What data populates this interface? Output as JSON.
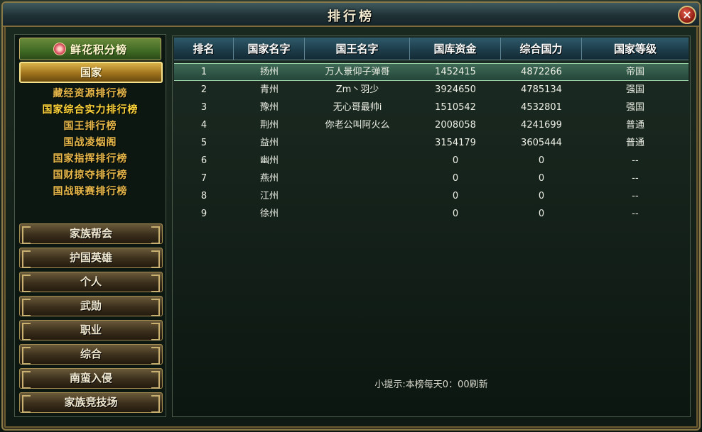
{
  "window": {
    "title": "排行榜",
    "close_label": "×"
  },
  "sidebar": {
    "header_label": "鲜花积分榜",
    "selected_category": "国家",
    "sub_items": [
      "藏经资源排行榜",
      "国家综合实力排行榜",
      "国王排行榜",
      "国战凌烟阁",
      "国家指挥排行榜",
      "国财掠夺排行榜",
      "国战联赛排行榜"
    ],
    "categories": [
      "家族帮会",
      "护国英雄",
      "个人",
      "武勋",
      "职业",
      "综合",
      "南蛮入侵",
      "家族竞技场"
    ]
  },
  "table": {
    "headers": [
      "排名",
      "国家名字",
      "国王名字",
      "国库资金",
      "综合国力",
      "国家等级"
    ],
    "rows": [
      [
        "1",
        "扬州",
        "万人景仰子弹哥",
        "1452415",
        "4872266",
        "帝国"
      ],
      [
        "2",
        "青州",
        "Zm丶羽少",
        "3924650",
        "4785134",
        "强国"
      ],
      [
        "3",
        "豫州",
        "无心哥最帅i",
        "1510542",
        "4532801",
        "强国"
      ],
      [
        "4",
        "荆州",
        "你老公叫阿火么",
        "2008058",
        "4241699",
        "普通"
      ],
      [
        "5",
        "益州",
        "",
        "3154179",
        "3605444",
        "普通"
      ],
      [
        "6",
        "幽州",
        "",
        "0",
        "0",
        "--"
      ],
      [
        "7",
        "燕州",
        "",
        "0",
        "0",
        "--"
      ],
      [
        "8",
        "江州",
        "",
        "0",
        "0",
        "--"
      ],
      [
        "9",
        "徐州",
        "",
        "0",
        "0",
        "--"
      ]
    ]
  },
  "tip": "小提示:本榜每天0：00刷新"
}
